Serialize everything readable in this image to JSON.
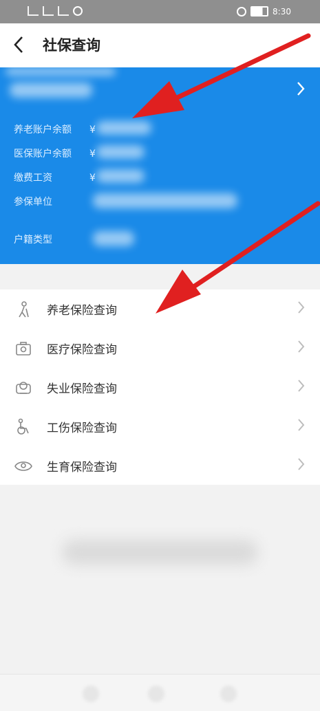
{
  "status_bar": {
    "time": "8:30"
  },
  "header": {
    "back_icon": "back-chevron-icon",
    "title": "社保查询"
  },
  "info_card": {
    "background": "#1a8ae8",
    "rows": [
      {
        "label": "养老账户余额",
        "prefix": "¥"
      },
      {
        "label": "医保账户余额",
        "prefix": "¥"
      },
      {
        "label": "缴费工资",
        "prefix": "¥"
      },
      {
        "label": "参保单位",
        "prefix": ""
      },
      {
        "label": "户籍类型",
        "prefix": ""
      }
    ]
  },
  "menu": {
    "items": [
      {
        "label": "养老保险查询",
        "icon": "elder-person-icon"
      },
      {
        "label": "医疗保险查询",
        "icon": "medical-camera-icon"
      },
      {
        "label": "失业保险查询",
        "icon": "unemployment-icon"
      },
      {
        "label": "工伤保险查询",
        "icon": "wheelchair-icon"
      },
      {
        "label": "生育保险查询",
        "icon": "maternity-icon"
      }
    ]
  },
  "annotations": {
    "arrow_color": "#e02020"
  }
}
